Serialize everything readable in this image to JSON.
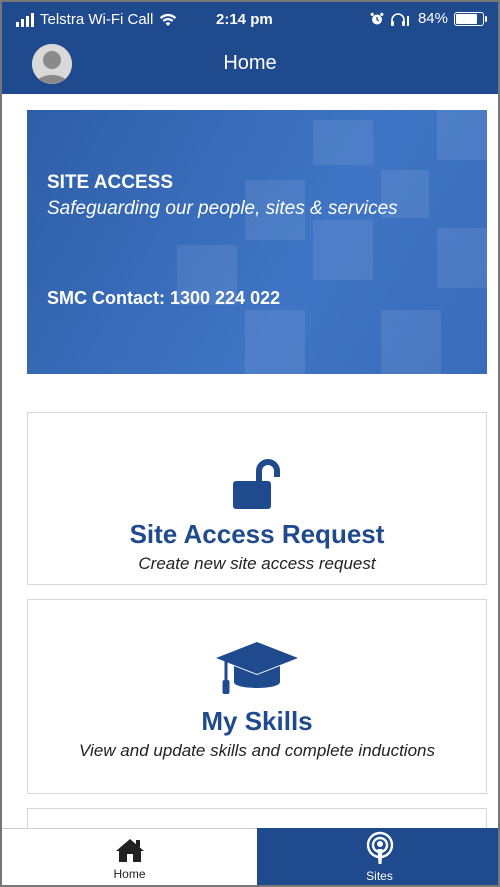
{
  "status_bar": {
    "carrier": "Telstra Wi-Fi Call",
    "time": "2:14 pm",
    "battery": "84%",
    "battery_level": 0.84
  },
  "header": {
    "title": "Home"
  },
  "banner": {
    "title": "SITE ACCESS",
    "subtitle": "Safeguarding our people, sites & services",
    "contact": "SMC Contact: 1300 224 022"
  },
  "cards": [
    {
      "icon": "unlock-icon",
      "title": "Site Access Request",
      "description": "Create new site access request"
    },
    {
      "icon": "graduation-cap-icon",
      "title": "My Skills",
      "description": "View and update skills and complete inductions"
    }
  ],
  "bottom_nav": {
    "items": [
      {
        "label": "Home",
        "icon": "home-icon"
      },
      {
        "label": "Sites",
        "icon": "podcast-icon"
      }
    ]
  },
  "colors": {
    "brand": "#1f4a8e",
    "banner": "#3a6cba"
  }
}
